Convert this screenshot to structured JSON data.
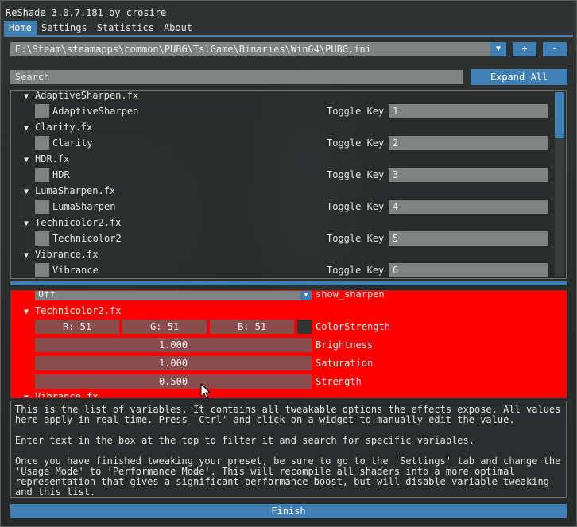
{
  "app": {
    "title": "ReShade 3.0.7.181 by crosire"
  },
  "menu": [
    "Home",
    "Settings",
    "Statistics",
    "About"
  ],
  "preset": {
    "path": "E:\\Steam\\steamapps\\common\\PUBG\\TslGame\\Binaries\\Win64\\PUBG.ini",
    "add_label": "+",
    "remove_label": "-"
  },
  "search": {
    "placeholder": "Search",
    "expand_label": "Expand All"
  },
  "effects": [
    {
      "file": "AdaptiveSharpen.fx",
      "name": "AdaptiveSharpen",
      "toggle_label": "Toggle Key",
      "key": "1"
    },
    {
      "file": "Clarity.fx",
      "name": "Clarity",
      "toggle_label": "Toggle Key",
      "key": "2"
    },
    {
      "file": "HDR.fx",
      "name": "HDR",
      "toggle_label": "Toggle Key",
      "key": "3"
    },
    {
      "file": "LumaSharpen.fx",
      "name": "LumaSharpen",
      "toggle_label": "Toggle Key",
      "key": "4"
    },
    {
      "file": "Technicolor2.fx",
      "name": "Technicolor2",
      "toggle_label": "Toggle Key",
      "key": "5"
    },
    {
      "file": "Vibrance.fx",
      "name": "Vibrance",
      "toggle_label": "Toggle Key",
      "key": "6"
    }
  ],
  "variables": {
    "show_sharpen_value": "Off",
    "show_sharpen_label": "show_sharpen",
    "technicolor_file": "Technicolor2.fx",
    "color_strength": {
      "r": "R: 51",
      "g": "G: 51",
      "b": "B: 51",
      "label": "ColorStrength",
      "swatch_color": "#333333"
    },
    "brightness": {
      "value": "1.000",
      "label": "Brightness"
    },
    "saturation": {
      "value": "1.000",
      "label": "Saturation"
    },
    "strength": {
      "value": "0.500",
      "label": "Strength"
    },
    "next_file": "Vibrance.fx"
  },
  "help": [
    "This is the list of variables. It contains all tweakable options the effects expose. All values here apply in real-time. Press 'Ctrl' and click on a widget to manually edit the value.",
    "Enter text in the box at the top to filter it and search for specific variables.",
    "Once you have finished tweaking your preset, be sure to go to the 'Settings' tab and change the 'Usage Mode' to 'Performance Mode'. This will recompile all shaders into a more optimal representation that gives a significant performance boost, but will disable variable tweaking and this list."
  ],
  "finish_label": "Finish",
  "colors": {
    "accent": "#3f7fb3",
    "variables_bg": "#ff0000",
    "input_bg": "#7e8281"
  }
}
